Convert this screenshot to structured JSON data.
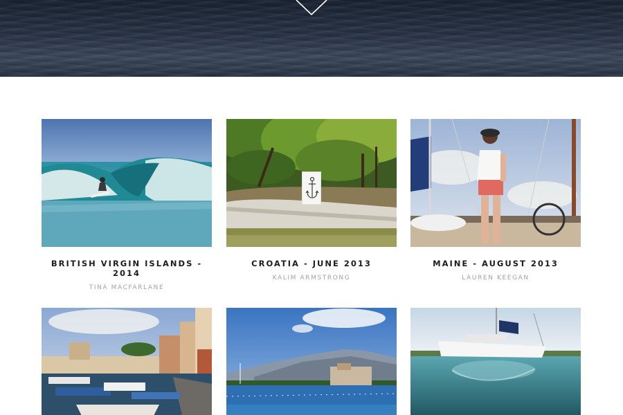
{
  "hero": {
    "arrow_icon": "chevron-down-icon"
  },
  "gallery": {
    "items": [
      {
        "title": "BRITISH VIRGIN ISLANDS - 2014",
        "author": "TINA MACFARLANE",
        "image": "surf-wave-photo"
      },
      {
        "title": "CROATIA - JUNE 2013",
        "author": "KALIM ARMSTRONG",
        "image": "rocky-shore-pines-photo",
        "badge_icon": "anchor-icon"
      },
      {
        "title": "MAINE - AUGUST 2013",
        "author": "LAUREN KEEGAN",
        "image": "sailboat-deck-photo"
      },
      {
        "title": "",
        "author": "",
        "image": "harbor-boats-photo"
      },
      {
        "title": "",
        "author": "",
        "image": "mountain-bay-photo"
      },
      {
        "title": "",
        "author": "",
        "image": "catamaran-underwater-photo"
      }
    ]
  },
  "colors": {
    "title_text": "#1d1d1d",
    "author_text": "#a2a2a2",
    "hero_ocean": "#2a3547"
  }
}
